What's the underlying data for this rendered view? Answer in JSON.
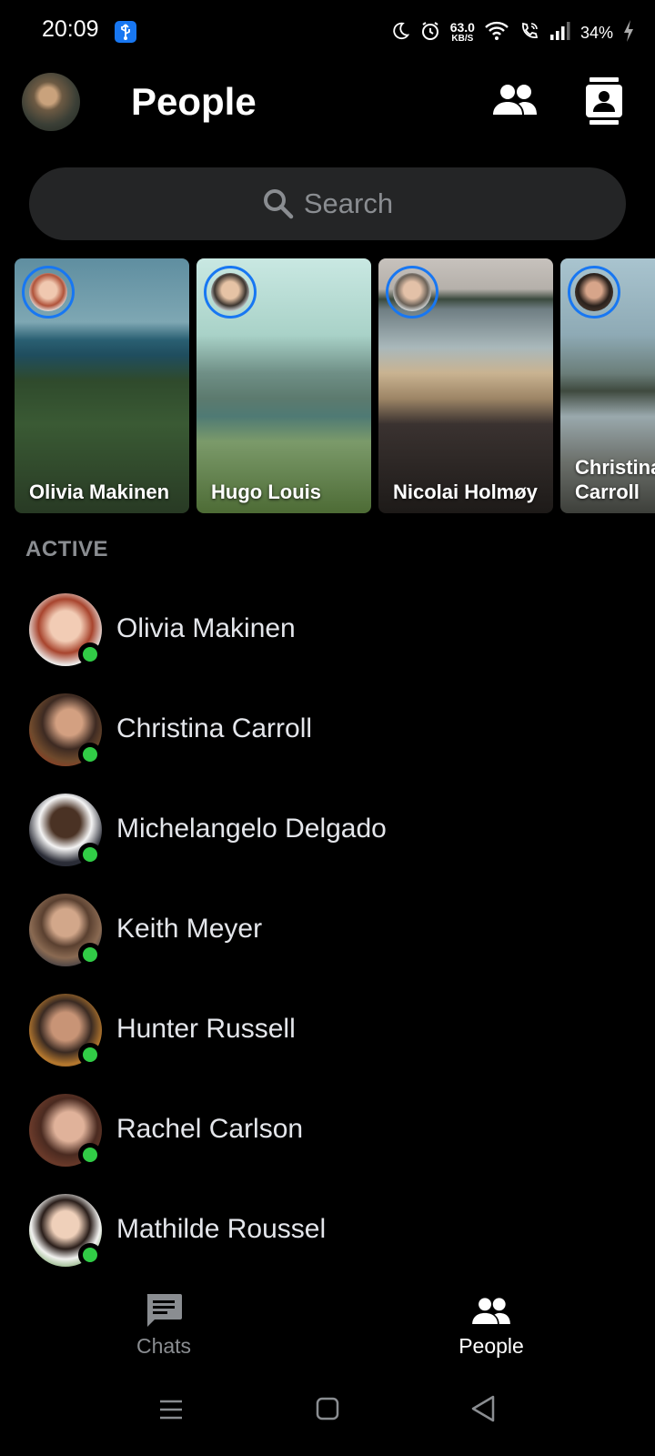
{
  "status_bar": {
    "time": "20:09",
    "net_speed_value": "63.0",
    "net_speed_unit": "KB/S",
    "battery": "34%"
  },
  "header": {
    "title": "People"
  },
  "search": {
    "placeholder": "Search"
  },
  "stories": [
    {
      "name": "Olivia Makinen"
    },
    {
      "name": "Hugo Louis"
    },
    {
      "name": "Nicolai Holmøy"
    },
    {
      "name": "Christina Carroll"
    }
  ],
  "active": {
    "label": "ACTIVE",
    "people": [
      {
        "name": "Olivia Makinen",
        "online": true
      },
      {
        "name": "Christina Carroll",
        "online": true
      },
      {
        "name": "Michelangelo Delgado",
        "online": true
      },
      {
        "name": "Keith Meyer",
        "online": true
      },
      {
        "name": "Hunter Russell",
        "online": true
      },
      {
        "name": "Rachel Carlson",
        "online": true
      },
      {
        "name": "Mathilde Roussel",
        "online": true
      }
    ]
  },
  "bottom_nav": {
    "chats_label": "Chats",
    "people_label": "People",
    "active_tab": "People"
  },
  "colors": {
    "accent": "#1877f2",
    "online": "#31cc46",
    "background": "#000000",
    "search_bg": "#242526",
    "muted_text": "#8a8d91"
  }
}
